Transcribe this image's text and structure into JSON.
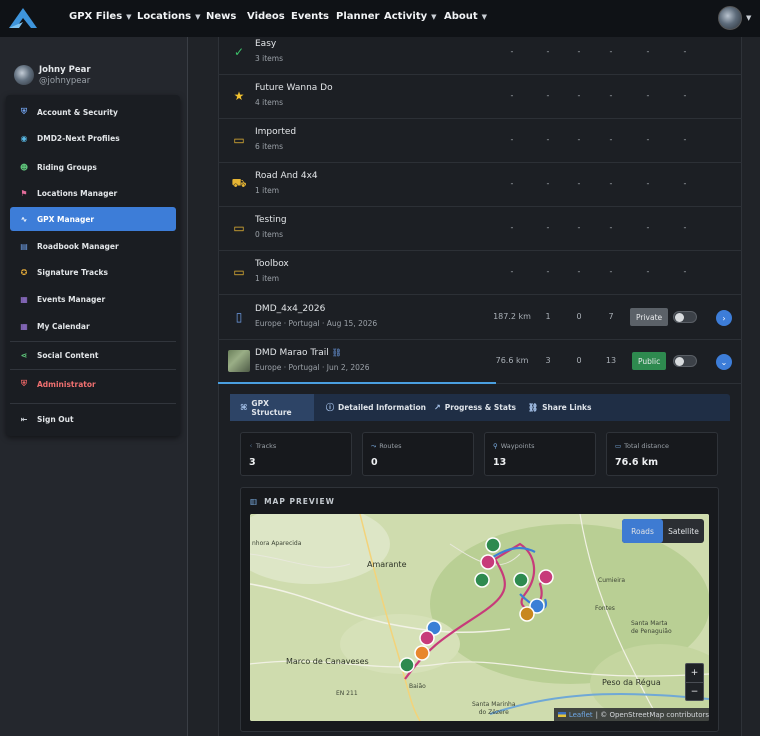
{
  "nav": {
    "items": [
      {
        "label": "GPX Files",
        "dropdown": true
      },
      {
        "label": "Locations",
        "dropdown": true
      },
      {
        "label": "News",
        "dropdown": false
      },
      {
        "label": "Videos",
        "dropdown": false
      },
      {
        "label": "Events",
        "dropdown": false
      },
      {
        "label": "Planner",
        "dropdown": false
      },
      {
        "label": "Activity",
        "dropdown": true
      },
      {
        "label": "About",
        "dropdown": true
      }
    ]
  },
  "user": {
    "name": "Johny Pear",
    "handle": "@johnypear"
  },
  "sidebar": {
    "items": [
      {
        "label": "Account & Security",
        "icon": "shield-icon",
        "color": "#6f9fe8"
      },
      {
        "label": "DMD2-Next Profiles",
        "icon": "user-circle-icon",
        "color": "#58b9e6"
      },
      {
        "label": "Riding Groups",
        "icon": "group-icon",
        "color": "#5ec47a"
      },
      {
        "label": "Locations Manager",
        "icon": "pin-icon",
        "color": "#e26c9a"
      },
      {
        "label": "GPX Manager",
        "icon": "route-icon",
        "color": "#ffffff"
      },
      {
        "label": "Roadbook Manager",
        "icon": "book-icon",
        "color": "#6f9fe8"
      },
      {
        "label": "Signature Tracks",
        "icon": "medal-icon",
        "color": "#e0a83a"
      },
      {
        "label": "Events Manager",
        "icon": "calendar-icon",
        "color": "#a57ee8"
      },
      {
        "label": "My Calendar",
        "icon": "calendar-icon",
        "color": "#a57ee8"
      },
      {
        "label": "Social Content",
        "icon": "share-icon",
        "color": "#5ec47a"
      },
      {
        "label": "Administrator",
        "icon": "shield-icon",
        "color": "#e06262"
      },
      {
        "label": "Sign Out",
        "icon": "logout-icon",
        "color": "#c9ced4"
      }
    ]
  },
  "folders": [
    {
      "title": "Easy",
      "sub": "3 items",
      "icon": "check-circle-icon",
      "color": "#3cc26a"
    },
    {
      "title": "Future Wanna Do",
      "sub": "4 items",
      "icon": "star-icon",
      "color": "#f2c230"
    },
    {
      "title": "Imported",
      "sub": "6 items",
      "icon": "folder-icon",
      "color": "#e6b534"
    },
    {
      "title": "Road And 4x4",
      "sub": "1 item",
      "icon": "car-icon",
      "color": "#e6b534"
    },
    {
      "title": "Testing",
      "sub": "0 items",
      "icon": "folder-icon",
      "color": "#e6b534"
    },
    {
      "title": "Toolbox",
      "sub": "1 item",
      "icon": "folder-icon",
      "color": "#e6b534"
    }
  ],
  "dash": "-",
  "files": [
    {
      "title": "DMD_4x4_2026",
      "sub": "Europe · Portugal · Aug 15, 2026",
      "distance": "187.2 km",
      "tracks": "1",
      "routes": "0",
      "waypoints": "7",
      "visibility": "Private",
      "action": "›"
    },
    {
      "title": "DMD Marao Trail",
      "sub": "Europe · Portugal · Jun 2, 2026",
      "distance": "76.6 km",
      "tracks": "3",
      "routes": "0",
      "waypoints": "13",
      "visibility": "Public",
      "action": "⌄"
    }
  ],
  "tabs": [
    {
      "label": "GPX Structure",
      "icon": "⌘"
    },
    {
      "label": "Detailed Information",
      "icon": "ⓘ"
    },
    {
      "label": "Progress & Stats",
      "icon": "↗"
    },
    {
      "label": "Share Links",
      "icon": "⛓"
    }
  ],
  "stats": [
    {
      "label": "Tracks",
      "value": "3",
      "icon": "ᚲ"
    },
    {
      "label": "Routes",
      "value": "0",
      "icon": "⤳"
    },
    {
      "label": "Waypoints",
      "value": "13",
      "icon": "⚲"
    },
    {
      "label": "Total distance",
      "value": "76.6 km",
      "icon": "▭"
    }
  ],
  "map": {
    "title": "MAP PREVIEW",
    "layers": [
      "Roads",
      "Satellite"
    ],
    "zoom_in": "+",
    "zoom_out": "−",
    "attribution_link": "Leaflet",
    "attribution_text": "| © OpenStreetMap contributors",
    "labels": {
      "amarante": "Amarante",
      "canaveses": "Marco de Canaveses",
      "regua": "Peso da Régua",
      "aparecida": "nhora Aparecida",
      "cumieira": "Cumieira",
      "fontes": "Fontes",
      "santa_marta": "Santa Marta\nde Penaguião",
      "baiao": "Baião",
      "zezere": "Santa Marinha\ndo Zêzere",
      "n211": "EN 211"
    }
  }
}
